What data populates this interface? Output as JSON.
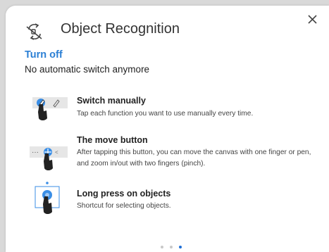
{
  "dialog": {
    "title": "Object Recognition",
    "mode_label": "Turn off",
    "mode_description": "No automatic switch anymore"
  },
  "icons": {
    "header": "object-recognition-icon",
    "close": "close-icon",
    "hand": "hand-pointer-icon",
    "pen": "pen-icon"
  },
  "features": [
    {
      "title": "Switch manually",
      "description": "Tap each function you want to use manually every time."
    },
    {
      "title": "The move button",
      "description": "After tapping this button, you can move the canvas with one finger or pen, and zoom in/out with two fingers (pinch)."
    },
    {
      "title": "Long press on objects",
      "description": "Shortcut for selecting objects."
    }
  ],
  "pagination": {
    "total": 3,
    "current": 3
  },
  "colors": {
    "accent": "#2b7fd4",
    "active_dot": "#1f6fd6",
    "highlight": "#3a8ee6"
  }
}
